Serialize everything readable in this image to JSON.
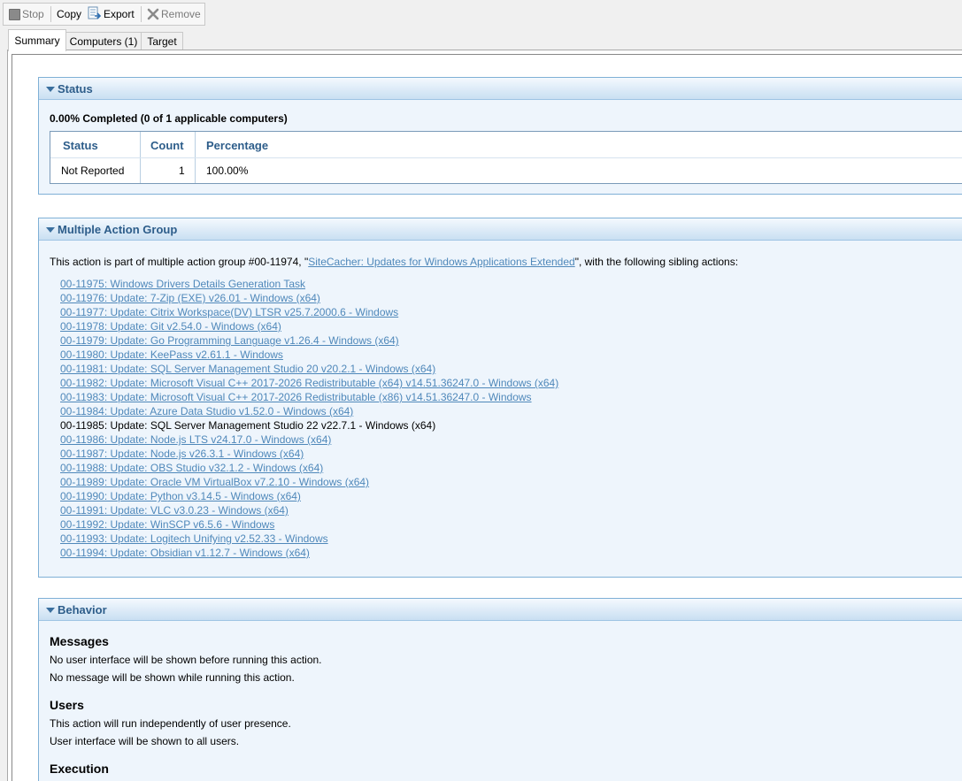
{
  "toolbar": {
    "stop_label": "Stop",
    "copy_label": "Copy",
    "export_label": "Export",
    "remove_label": "Remove"
  },
  "tabs": [
    {
      "label": "Summary"
    },
    {
      "label": "Computers (1)"
    },
    {
      "label": "Target"
    }
  ],
  "status": {
    "header": "Status",
    "summary": "0.00% Completed (0 of 1 applicable computers)",
    "columns": [
      "Status",
      "Count",
      "Percentage"
    ],
    "rows": [
      {
        "status": "Not Reported",
        "count": "1",
        "percentage": "100.00%"
      }
    ]
  },
  "mag": {
    "header": "Multiple Action Group",
    "intro_before": "This action is part of multiple action group #00-11974, \"",
    "intro_link": "SiteCacher: Updates for Windows Applications Extended",
    "intro_after": "\", with the following sibling actions:",
    "actions": [
      {
        "text": "00-11975: Windows Drivers Details Generation Task",
        "link": true
      },
      {
        "text": "00-11976: Update: 7-Zip (EXE) v26.01 - Windows (x64)",
        "link": true
      },
      {
        "text": "00-11977: Update: Citrix Workspace(DV) LTSR v25.7.2000.6 - Windows",
        "link": true
      },
      {
        "text": "00-11978: Update: Git v2.54.0 - Windows (x64)",
        "link": true
      },
      {
        "text": "00-11979: Update: Go Programming Language v1.26.4 - Windows (x64)",
        "link": true
      },
      {
        "text": "00-11980: Update: KeePass v2.61.1 - Windows",
        "link": true
      },
      {
        "text": "00-11981: Update: SQL Server Management Studio 20 v20.2.1 - Windows (x64)",
        "link": true
      },
      {
        "text": "00-11982: Update: Microsoft Visual C++ 2017-2026 Redistributable (x64) v14.51.36247.0 - Windows (x64)",
        "link": true
      },
      {
        "text": "00-11983: Update: Microsoft Visual C++ 2017-2026 Redistributable (x86) v14.51.36247.0 - Windows",
        "link": true
      },
      {
        "text": "00-11984: Update: Azure Data Studio v1.52.0 - Windows (x64)",
        "link": true
      },
      {
        "text": "00-11985: Update: SQL Server Management Studio 22 v22.7.1 - Windows (x64)",
        "link": false
      },
      {
        "text": "00-11986: Update: Node.js LTS v24.17.0 - Windows (x64)",
        "link": true
      },
      {
        "text": "00-11987: Update: Node.js v26.3.1 - Windows (x64)",
        "link": true
      },
      {
        "text": "00-11988: Update: OBS Studio v32.1.2 - Windows (x64)",
        "link": true
      },
      {
        "text": "00-11989: Update: Oracle VM VirtualBox v7.2.10 - Windows (x64)",
        "link": true
      },
      {
        "text": "00-11990: Update: Python v3.14.5 - Windows (x64)",
        "link": true
      },
      {
        "text": "00-11991: Update: VLC v3.0.23 - Windows (x64)",
        "link": true
      },
      {
        "text": "00-11992: Update: WinSCP v6.5.6 - Windows",
        "link": true
      },
      {
        "text": "00-11993: Update: Logitech Unifying v2.52.33 - Windows",
        "link": true
      },
      {
        "text": "00-11994: Update: Obsidian v1.12.7 - Windows (x64)",
        "link": true
      }
    ]
  },
  "behavior": {
    "header": "Behavior",
    "messages_title": "Messages",
    "messages_line1": "No user interface will be shown before running this action.",
    "messages_line2": "No message will be shown while running this action.",
    "users_title": "Users",
    "users_line1": "This action will run independently of user presence.",
    "users_line2": "User interface will be shown to all users.",
    "execution_title": "Execution"
  }
}
